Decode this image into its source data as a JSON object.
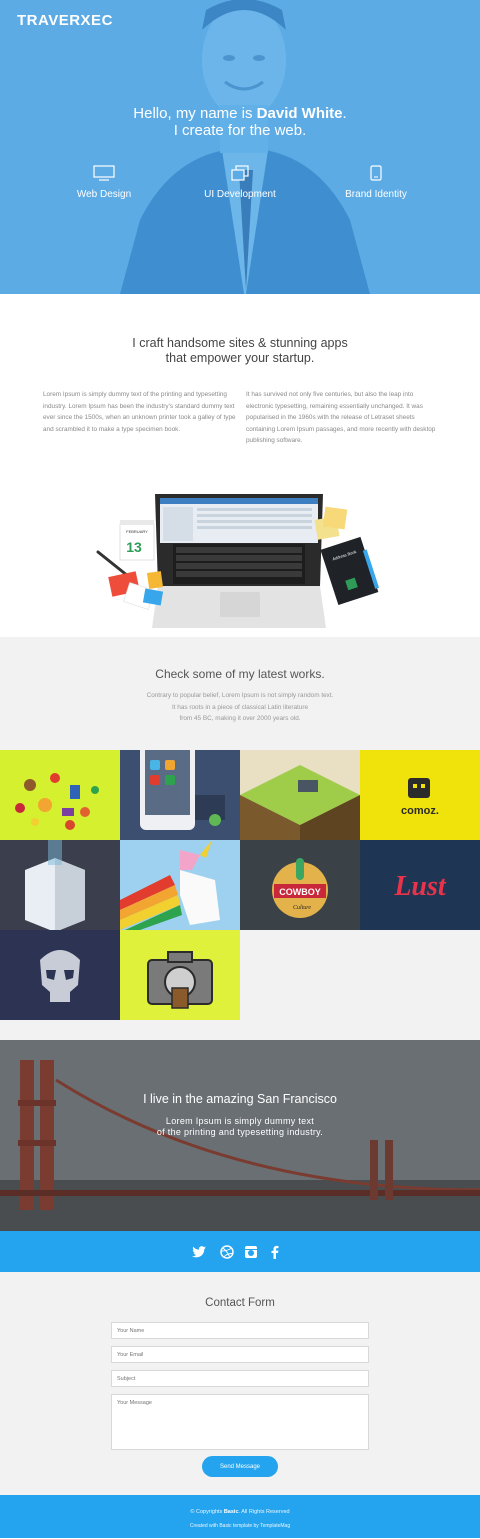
{
  "header": {
    "brand": "TRAVERXEC",
    "title_prefix": "Hello, my name is ",
    "title_name": "David White",
    "title_suffix": ".",
    "subtitle": "I create for the web.",
    "services": [
      {
        "label": "Web Design",
        "icon": "monitor-icon"
      },
      {
        "label": "UI Development",
        "icon": "layers-icon"
      },
      {
        "label": "Brand Identity",
        "icon": "mobile-icon"
      }
    ],
    "accent_color": "#5dabe5"
  },
  "about": {
    "heading_line1": "I craft handsome sites & stunning apps",
    "heading_line2": "that empower your startup.",
    "col_left": "Lorem Ipsum is simply dummy text of the printing and typesetting industry. Lorem Ipsum has been the industry's standard dummy text ever since the 1500s, when an unknown printer took a galley of type and scrambled it to make a type specimen book.",
    "col_right": "It has survived not only five centuries, but also the leap into electronic typesetting, remaining essentially unchanged. It was popularised in the 1960s with the release of Letraset sheets containing Lorem Ipsum passages, and more recently with desktop publishing software.",
    "calendar_month": "FEBRUARY",
    "calendar_day": "13",
    "notebook_label": "Address Book"
  },
  "works": {
    "heading": "Check some of my latest works.",
    "desc_line1": "Contrary to popular belief, Lorem Ipsum is not simply random text.",
    "desc_line2": "It has roots in a piece of classical Latin literature",
    "desc_line3": "from 45 BC, making it over 2000 years old.",
    "tiles": [
      {
        "name": "portfolio-food-icons",
        "bg": "#d4f02e"
      },
      {
        "name": "portfolio-tablet-apps",
        "bg": "#3c4f70"
      },
      {
        "name": "portfolio-isometric-island",
        "bg": "#e9dfc2"
      },
      {
        "name": "portfolio-comoz-logo",
        "bg": "#f0e20b",
        "text": "comoz."
      },
      {
        "name": "portfolio-isometric-room",
        "bg": "#3b3f4d"
      },
      {
        "name": "portfolio-unicorn",
        "bg": "#9ed1ef"
      },
      {
        "name": "portfolio-cowboy-culture",
        "bg": "#3a4147",
        "text": "COWBOY",
        "text2": "Culture"
      },
      {
        "name": "portfolio-lust-lettering",
        "bg": "#1e3553",
        "text": "Lust"
      },
      {
        "name": "portfolio-skull",
        "bg": "#2d3453"
      },
      {
        "name": "portfolio-camera",
        "bg": "#dff13a"
      }
    ]
  },
  "city": {
    "heading": "I live in the amazing San Francisco",
    "sub_line1": "Lorem Ipsum is simply dummy text",
    "sub_line2": "of the printing and typesetting industry."
  },
  "social": {
    "icons": [
      "twitter-icon",
      "dribbble-icon",
      "instagram-icon",
      "facebook-icon"
    ]
  },
  "contact": {
    "heading": "Contact Form",
    "name_placeholder": "Your Name",
    "email_placeholder": "Your Email",
    "subject_placeholder": "Subject",
    "message_placeholder": "Your Message",
    "send_label": "Send Message"
  },
  "footer": {
    "copy_prefix": "© Copyrights ",
    "copy_brand": "Basic",
    "copy_suffix": ". All Rights Reserved",
    "credit": "Created with Basic template by TemplateMag"
  }
}
